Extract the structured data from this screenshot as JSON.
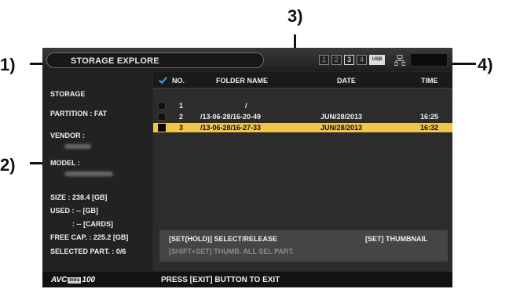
{
  "callouts": [
    "1)",
    "2)",
    "3)",
    "4)"
  ],
  "window": {
    "title": "STORAGE EXPLORE"
  },
  "slots": [
    {
      "label": "1",
      "active": false
    },
    {
      "label": "2",
      "active": false
    },
    {
      "label": "3",
      "active": true
    },
    {
      "label": "4",
      "active": false
    },
    {
      "label": "USB",
      "active": true
    }
  ],
  "storage": {
    "heading": "STORAGE",
    "partition": "PARTITION : FAT",
    "vendor_label": "VENDOR :",
    "model_label": "MODEL :",
    "size": "SIZE : 238.4 [GB]",
    "used": "USED : -- [GB]",
    "cards": ": -- [CARDS]",
    "free": "FREE CAP. : 225.2 [GB]",
    "selected": "SELECTED PART. : 0/6"
  },
  "table": {
    "columns": [
      "NO.",
      "FOLDER NAME",
      "DATE",
      "TIME"
    ],
    "rows": [
      {
        "no": "1",
        "folder": "/",
        "date": "",
        "time": "",
        "selected": false
      },
      {
        "no": "2",
        "folder": "/13-06-28/16-20-49",
        "date": "JUN/28/2013",
        "time": "16:25",
        "selected": false
      },
      {
        "no": "3",
        "folder": "/13-06-28/16-27-33",
        "date": "JUN/28/2013",
        "time": "16:32",
        "selected": true
      }
    ]
  },
  "help": {
    "select": "[SET(HOLD)] SELECT/RELEASE",
    "thumbnail": "[SET] THUMBNAIL",
    "shift": "[SHIFT+SET] THUMB. ALL SEL PART."
  },
  "footer": {
    "logo_avc": "AVC",
    "logo_badge": "Intra",
    "logo_num": "100",
    "exit": "PRESS [EXIT] BUTTON TO EXIT"
  },
  "colors": {
    "selection": "#f1c44b",
    "background": "#262626"
  }
}
